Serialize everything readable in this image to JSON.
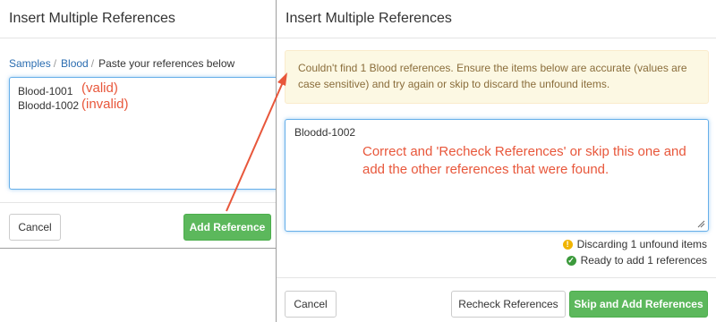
{
  "left_dialog": {
    "title": "Insert Multiple References",
    "breadcrumb": [
      "Samples",
      "Blood",
      "Paste your references below"
    ],
    "textarea_lines": [
      "Blood-1001",
      "Bloodd-1002"
    ],
    "annotations": [
      "(valid)",
      "(invalid)"
    ],
    "cancel_label": "Cancel",
    "add_label": "Add Reference"
  },
  "right_dialog": {
    "title": "Insert Multiple References",
    "warning_line1": "Couldn't find 1 Blood references. Ensure the items below are accurate (values are",
    "warning_line2": "case sensitive) and try again or skip to discard the unfound items.",
    "textarea_value": "Bloodd-1002",
    "annotation_line1": "Correct and 'Recheck References' or skip this one and",
    "annotation_line2": "add the other references that were found.",
    "status_discard": "Discarding 1 unfound items",
    "status_ready": "Ready to add 1 references",
    "cancel_label": "Cancel",
    "recheck_label": "Recheck References",
    "skip_add_label": "Skip and Add References"
  },
  "colors": {
    "annotation": "#e8573b",
    "link": "#2a6cb0",
    "success": "#5cb85c",
    "warning_bg": "#fcf8e3",
    "warning_text": "#8a6d3b",
    "warning_icon": "#f0b400",
    "ok_icon": "#3c9a3c"
  },
  "icons": {
    "discard": "warning-circle-icon",
    "ready": "check-circle-icon"
  }
}
